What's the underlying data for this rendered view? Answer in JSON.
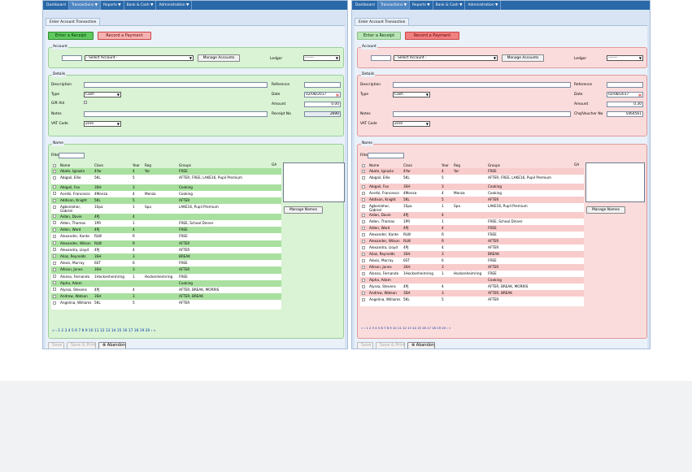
{
  "nav": [
    {
      "label": "Dashboard"
    },
    {
      "label": "Transactions ▼",
      "active": true
    },
    {
      "label": "Reports ▼"
    },
    {
      "label": "Bank & Cash ▼"
    },
    {
      "label": "Administration ▼"
    }
  ],
  "tab_label": "Enter Account Transaction",
  "buttons": {
    "receipt": "Enter a Receipt",
    "payment": "Record a Payment",
    "manage_accounts": "Manage Accounts",
    "manage_names": "Manage Names",
    "save": "Save",
    "save_print": "Save & Print",
    "abandon": "⊗ Abandon"
  },
  "account": {
    "legend": "Account",
    "select_placeholder": "- Select Account -",
    "ledger_label": "Ledger",
    "ledger_value": "-------"
  },
  "details": {
    "legend": "Details",
    "description_label": "Description",
    "reference_label": "Reference",
    "type_label": "Type",
    "type_value": "Cash",
    "date_label": "Date",
    "date_value": "02/08/2017",
    "giftaid_label": "Gift Aid",
    "amount_label": "Amount",
    "amount_value_left": "0.00",
    "amount_value_right": "0.30",
    "notes_label": "Notes",
    "receipt_label": "Receipt No",
    "receipt_value": "2690",
    "cheque_label": "Chq/Voucher No",
    "cheque_value": "5464561",
    "vat_label": "VAT Code",
    "vat_value": "Zero"
  },
  "names": {
    "legend": "Name",
    "filter_label": "Filter",
    "columns": [
      "Name",
      "Class",
      "Year",
      "Reg",
      "Groups",
      "GA"
    ],
    "rows": [
      [
        "Abate, Ignazio",
        "4Yar",
        "4",
        "Yar",
        "FREE"
      ],
      [
        "Abigail, Ellie",
        "5KL",
        "5",
        "",
        "AFTER, FREE, LAKE16, Pupil Premium"
      ],
      [
        "Abigail, Fox",
        "3SH",
        "3",
        "",
        "Cooking"
      ],
      [
        "Acerbi, Francesco",
        "4Monza",
        "4",
        "Monza",
        "Cooking"
      ],
      [
        "Addison, Knight",
        "5KL",
        "5",
        "",
        "AFTER"
      ],
      [
        "Agbonlahor, Gabriel",
        "1Spa",
        "1",
        "Spa",
        "LAKE16, Pupil Premium"
      ],
      [
        "Aidan, Davie",
        "4PJ",
        "4",
        "",
        ""
      ],
      [
        "Alden, Thomas",
        "1PR",
        "1",
        "",
        "FREE, School Dinner"
      ],
      [
        "Alden, Ward",
        "4PJ",
        "4",
        "",
        "FREE"
      ],
      [
        "Alexander, Kante",
        "RLW",
        "R",
        "",
        "FREE"
      ],
      [
        "Alexander, Wilson",
        "RLW",
        "R",
        "",
        "AFTER"
      ],
      [
        "Alexandra, Lloyd",
        "4PJ",
        "4",
        "",
        "AFTER"
      ],
      [
        "Aliaz, Reynolds",
        "3SH",
        "3",
        "",
        "BREAK"
      ],
      [
        "Alexis, Murray",
        "6ST",
        "6",
        "",
        "FREE"
      ],
      [
        "Allison, Jones",
        "3SH",
        "3",
        "",
        "AFTER"
      ],
      [
        "Alonso, Fernando",
        "1Hockenheimring",
        "1",
        "Hockenheimring",
        "FREE"
      ],
      [
        "Alpha, Adam",
        "",
        "",
        "",
        "Cooking"
      ],
      [
        "Alyssa, Stevens",
        "4PJ",
        "4",
        "",
        "AFTER, BREAK, MORRIS"
      ],
      [
        "Andrew, Watson",
        "3SH",
        "3",
        "",
        "AFTER, BREAK"
      ],
      [
        "Angelina, Williams",
        "5KL",
        "5",
        "",
        "AFTER"
      ]
    ],
    "pager_left": "« ‹ 1 2 3 4 5 6 7 8 9 10 11 12 13 14 15 16 17 18 19 20 › »",
    "pager_right": "« ‹ 1 2 3 4 5 6 7 8 9 10 11 12 13 14 15 16 17 18 19 20 › »"
  }
}
